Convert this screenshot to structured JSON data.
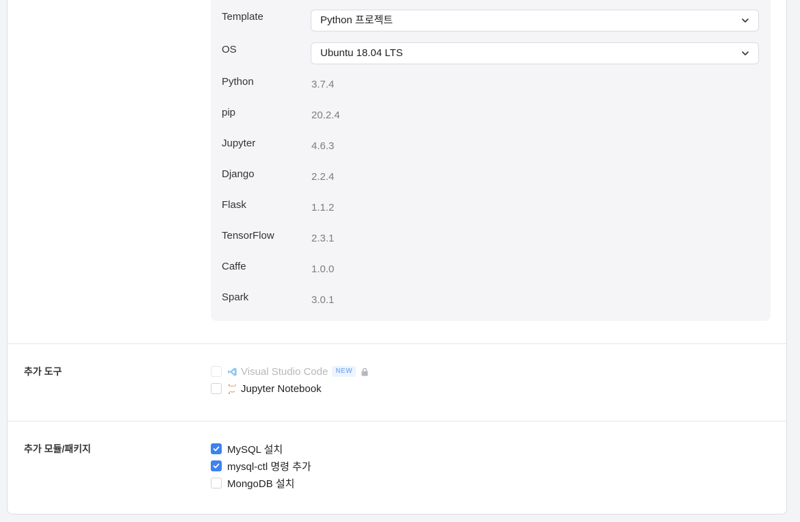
{
  "environment": {
    "template": {
      "label": "Template",
      "value": "Python 프로젝트"
    },
    "os": {
      "label": "OS",
      "value": "Ubuntu 18.04 LTS"
    },
    "versions": [
      {
        "label": "Python",
        "value": "3.7.4"
      },
      {
        "label": "pip",
        "value": "20.2.4"
      },
      {
        "label": "Jupyter",
        "value": "4.6.3"
      },
      {
        "label": "Django",
        "value": "2.2.4"
      },
      {
        "label": "Flask",
        "value": "1.1.2"
      },
      {
        "label": "TensorFlow",
        "value": "2.3.1"
      },
      {
        "label": "Caffe",
        "value": "1.0.0"
      },
      {
        "label": "Spark",
        "value": "3.0.1"
      }
    ]
  },
  "tools": {
    "title": "추가 도구",
    "items": [
      {
        "label": "Visual Studio Code",
        "badge": "NEW",
        "checked": false,
        "disabled": true,
        "icon": "vscode-icon",
        "locked": true
      },
      {
        "label": "Jupyter Notebook",
        "checked": false,
        "disabled": false,
        "icon": "jupyter-icon"
      }
    ]
  },
  "packages": {
    "title": "추가 모듈/패키지",
    "items": [
      {
        "label": "MySQL 설치",
        "checked": true
      },
      {
        "label": "mysql-ctl 명령 추가",
        "checked": true
      },
      {
        "label": "MongoDB 설치",
        "checked": false
      }
    ]
  },
  "colors": {
    "accent": "#3d82f0",
    "panel_bg": "#f5f5f7",
    "value_text": "#7c7c85"
  }
}
